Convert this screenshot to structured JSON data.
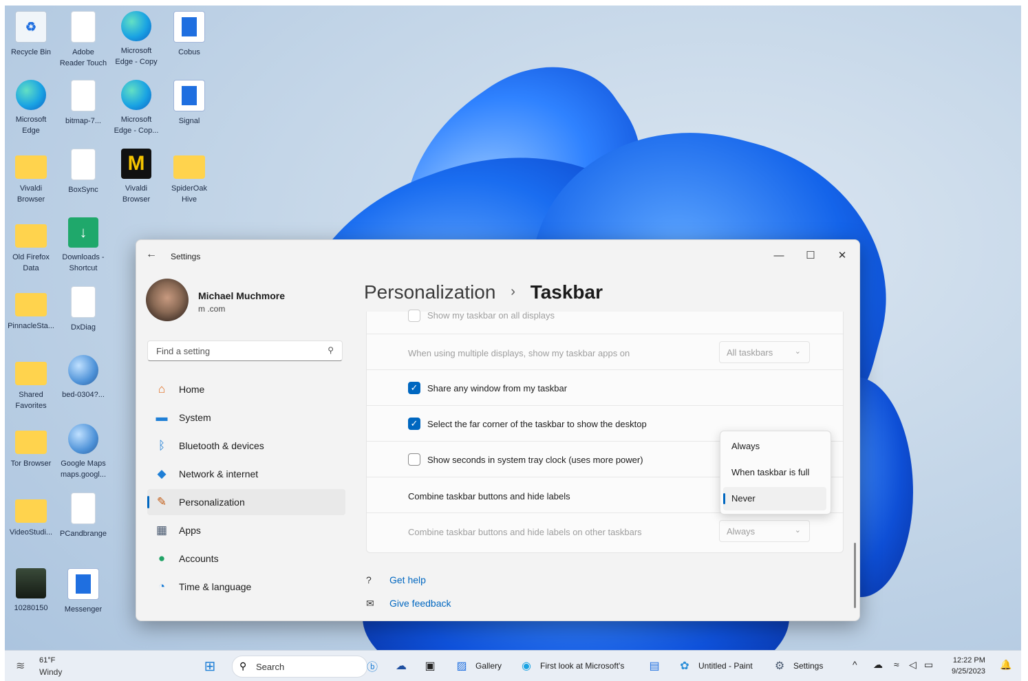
{
  "desktop": {
    "icons": [
      {
        "label": "Recycle Bin",
        "icon": "recycle-bin-icon"
      },
      {
        "label": "Adobe\nReader Touch",
        "icon": "document-icon"
      },
      {
        "label": "Microsoft\nEdge - Copy",
        "icon": "edge-icon"
      },
      {
        "label": "Cobus",
        "icon": "app-shortcut-icon"
      },
      {
        "label": "Microsoft\nEdge",
        "icon": "edge-icon"
      },
      {
        "label": "bitmap-7...",
        "icon": "image-file-icon"
      },
      {
        "label": "Microsoft\nEdge - Cop...",
        "icon": "edge-icon"
      },
      {
        "label": "Signal",
        "icon": "app-shortcut-icon"
      },
      {
        "label": "Vivaldi\nBrowser",
        "icon": "folder-icon"
      },
      {
        "label": "BoxSync",
        "icon": "document-icon"
      },
      {
        "label": "Vivaldi\nBrowser",
        "icon": "malwarebytes-icon"
      },
      {
        "label": "SpiderOak\nHive",
        "icon": "folder-icon"
      },
      {
        "label": "Old Firefox\nData",
        "icon": "folder-icon"
      },
      {
        "label": "Downloads -\nShortcut",
        "icon": "downloads-icon"
      },
      {
        "label": "PinnacleSta...",
        "icon": "folder-icon"
      },
      {
        "label": "DxDiag",
        "icon": "document-icon"
      },
      {
        "label": "Shared\nFavorites",
        "icon": "folder-icon"
      },
      {
        "label": "bed-0304?...",
        "icon": "globe-icon"
      },
      {
        "label": "Tor Browser",
        "icon": "folder-icon"
      },
      {
        "label": "Google Maps\nmaps.googl...",
        "icon": "globe-icon"
      },
      {
        "label": "VideoStudi...",
        "icon": "folder-icon"
      },
      {
        "label": "PCandbrange",
        "icon": "document-icon"
      },
      {
        "label": "10280150",
        "icon": "photo-icon"
      },
      {
        "label": "Messenger",
        "icon": "app-shortcut-icon"
      }
    ]
  },
  "window": {
    "app_title": "Settings",
    "controls": {
      "minimize": "—",
      "maximize": "☐",
      "close": "✕"
    },
    "back_icon": "←",
    "user": {
      "name": "Michael Muchmore",
      "email": "m                             .com"
    },
    "search_placeholder": "Find a setting",
    "nav": [
      {
        "label": "Home",
        "icon": "home-icon",
        "glyph": "⌂",
        "color": "#e06a1b"
      },
      {
        "label": "System",
        "icon": "system-icon",
        "glyph": "▬",
        "color": "#1f7fd6"
      },
      {
        "label": "Bluetooth & devices",
        "icon": "bluetooth-icon",
        "glyph": "ᛒ",
        "color": "#1f7fd6"
      },
      {
        "label": "Network & internet",
        "icon": "network-icon",
        "glyph": "◆",
        "color": "#1f7fd6"
      },
      {
        "label": "Personalization",
        "icon": "brush-icon",
        "glyph": "✎",
        "color": "#c25a12",
        "active": true
      },
      {
        "label": "Apps",
        "icon": "apps-icon",
        "glyph": "▦",
        "color": "#4a5a70"
      },
      {
        "label": "Accounts",
        "icon": "accounts-icon",
        "glyph": "●",
        "color": "#21a366"
      },
      {
        "label": "Time & language",
        "icon": "time-language-icon",
        "glyph": "◔",
        "color": "#1f7fd6"
      }
    ],
    "breadcrumb": {
      "parent": "Personalization",
      "separator": "›",
      "current": "Taskbar"
    },
    "settings": {
      "show_all_displays": {
        "label": "Show my taskbar on all displays",
        "checked": false,
        "enabled": false
      },
      "multi_display": {
        "label": "When using multiple displays, show my taskbar apps on",
        "value": "All taskbars",
        "enabled": false
      },
      "share_window": {
        "label": "Share any window from my taskbar",
        "checked": true
      },
      "far_corner": {
        "label": "Select the far corner of the taskbar to show the desktop",
        "checked": true
      },
      "show_seconds": {
        "label": "Show seconds in system tray clock (uses more power)",
        "checked": false
      },
      "combine": {
        "label": "Combine taskbar buttons and hide labels"
      },
      "combine_other": {
        "label": "Combine taskbar buttons and hide labels on other taskbars",
        "value": "Always",
        "enabled": false
      }
    },
    "combine_menu": {
      "options": [
        "Always",
        "When taskbar is full",
        "Never"
      ],
      "selected": "Never"
    },
    "links": [
      {
        "label": "Get help",
        "icon": "help-icon",
        "glyph": "?"
      },
      {
        "label": "Give feedback",
        "icon": "feedback-icon",
        "glyph": "✉"
      }
    ]
  },
  "taskbar": {
    "weather": {
      "temp": "61°F",
      "condition": "Windy"
    },
    "search_placeholder": "Search",
    "apps": [
      {
        "label": "Gallery",
        "icon": "gallery-icon"
      },
      {
        "label": "First look at Microsoft's",
        "icon": "edge-icon"
      },
      {
        "label": "Untitled - Paint",
        "icon": "paint-icon"
      },
      {
        "label": "Settings",
        "icon": "settings-gear-icon"
      }
    ],
    "clock": {
      "time": "12:22 PM",
      "date": "9/25/2023"
    }
  }
}
